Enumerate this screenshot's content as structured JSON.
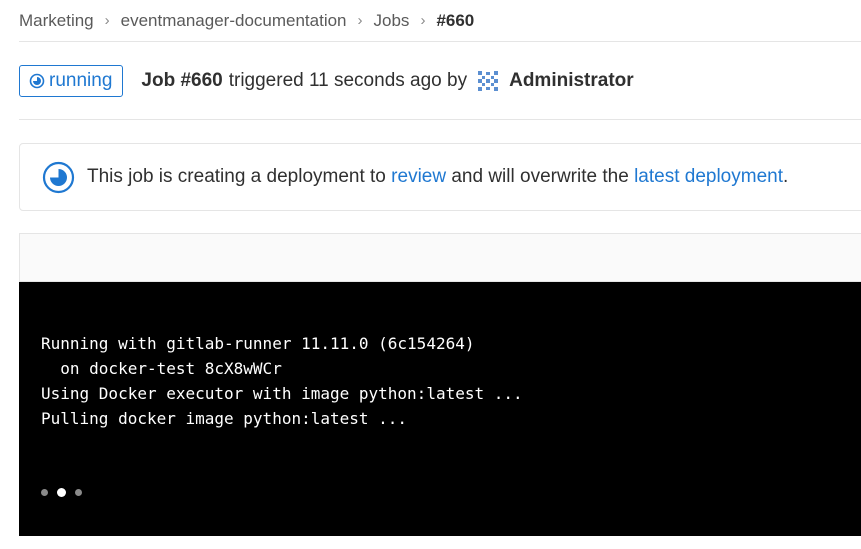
{
  "breadcrumb": {
    "group": "Marketing",
    "project": "eventmanager-documentation",
    "section": "Jobs",
    "current": "#660"
  },
  "job": {
    "status": "running",
    "id_label": "Job #660",
    "triggered_text": "triggered 11 seconds ago by",
    "user": "Administrator",
    "status_color": "#1f78d1"
  },
  "deployment": {
    "text_before": "This job is creating a deployment to",
    "environment_link": "review",
    "text_middle": "and will overwrite the",
    "latest_link": "latest deployment",
    "text_after": "."
  },
  "log": {
    "lines": [
      "Running with gitlab-runner 11.11.0 (6c154264)",
      "  on docker-test 8cX8wWCr",
      "Using Docker executor with image python:latest ...",
      "Pulling docker image python:latest ..."
    ]
  },
  "icons": {
    "status": "running-status-icon",
    "avatar": "identicon-avatar",
    "deploy": "deployment-running-icon"
  }
}
